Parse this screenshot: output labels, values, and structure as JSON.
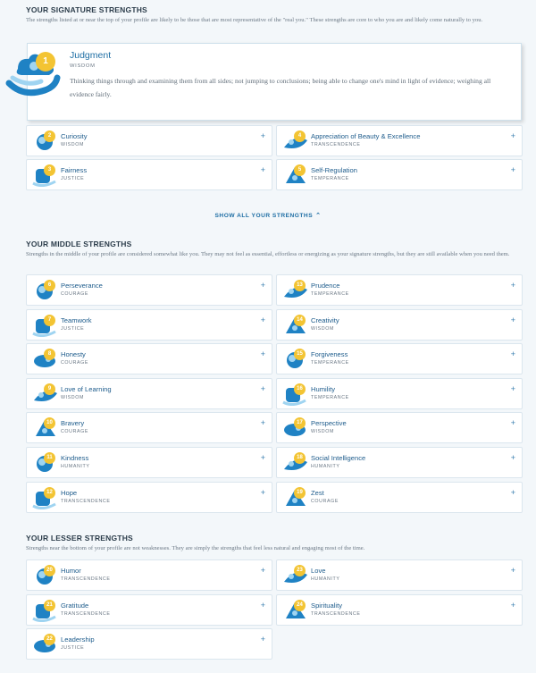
{
  "signature": {
    "title": "YOUR SIGNATURE STRENGTHS",
    "description": "The strengths listed at or near the top of your profile are likely to be those that are most representative of the \"real you.\" These strengths are core to who you are and likely come naturally to you.",
    "featured": {
      "rank": "1",
      "name": "Judgment",
      "category": "WISDOM",
      "description": "Thinking things through and examining them from all sides; not jumping to conclusions; being able to change one's mind in light of evidence; weighing all evidence fairly.",
      "icon": "judgment-icon"
    },
    "items": [
      {
        "rank": "2",
        "name": "Curiosity",
        "category": "WISDOM",
        "icon": "curiosity-icon"
      },
      {
        "rank": "4",
        "name": "Appreciation of Beauty & Excellence",
        "category": "TRANSCENDENCE",
        "icon": "beauty-icon"
      },
      {
        "rank": "3",
        "name": "Fairness",
        "category": "JUSTICE",
        "icon": "fairness-icon"
      },
      {
        "rank": "5",
        "name": "Self-Regulation",
        "category": "TEMPERANCE",
        "icon": "self-regulation-icon"
      }
    ],
    "show_all_label": "SHOW ALL YOUR STRENGTHS",
    "show_all_icon": "chevron-up-icon"
  },
  "middle": {
    "title": "YOUR MIDDLE STRENGTHS",
    "description": "Strengths in the middle of your profile are considered somewhat like you. They may not feel as essential, effortless or energizing as your signature strengths, but they are still available when you need them.",
    "items": [
      {
        "rank": "6",
        "name": "Perseverance",
        "category": "COURAGE"
      },
      {
        "rank": "13",
        "name": "Prudence",
        "category": "TEMPERANCE"
      },
      {
        "rank": "7",
        "name": "Teamwork",
        "category": "JUSTICE"
      },
      {
        "rank": "14",
        "name": "Creativity",
        "category": "WISDOM"
      },
      {
        "rank": "8",
        "name": "Honesty",
        "category": "COURAGE"
      },
      {
        "rank": "15",
        "name": "Forgiveness",
        "category": "TEMPERANCE"
      },
      {
        "rank": "9",
        "name": "Love of Learning",
        "category": "WISDOM"
      },
      {
        "rank": "16",
        "name": "Humility",
        "category": "TEMPERANCE"
      },
      {
        "rank": "10",
        "name": "Bravery",
        "category": "COURAGE"
      },
      {
        "rank": "17",
        "name": "Perspective",
        "category": "WISDOM"
      },
      {
        "rank": "11",
        "name": "Kindness",
        "category": "HUMANITY"
      },
      {
        "rank": "18",
        "name": "Social Intelligence",
        "category": "HUMANITY"
      },
      {
        "rank": "12",
        "name": "Hope",
        "category": "TRANSCENDENCE"
      },
      {
        "rank": "19",
        "name": "Zest",
        "category": "COURAGE"
      }
    ]
  },
  "lesser": {
    "title": "YOUR LESSER STRENGTHS",
    "description": "Strengths near the bottom of your profile are not weaknesses. They are simply the strengths that feel less natural and engaging most of the time.",
    "items": [
      {
        "rank": "20",
        "name": "Humor",
        "category": "TRANSCENDENCE"
      },
      {
        "rank": "23",
        "name": "Love",
        "category": "HUMANITY"
      },
      {
        "rank": "21",
        "name": "Gratitude",
        "category": "TRANSCENDENCE"
      },
      {
        "rank": "24",
        "name": "Spirituality",
        "category": "TRANSCENDENCE"
      },
      {
        "rank": "22",
        "name": "Leadership",
        "category": "JUSTICE"
      }
    ]
  },
  "plus_glyph": "+",
  "colors": {
    "accent": "#1e6ea4",
    "badge": "#f3c433",
    "icon_blue": "#1f82c4",
    "icon_light": "#9fd4f1",
    "background": "#f3f7fa"
  }
}
